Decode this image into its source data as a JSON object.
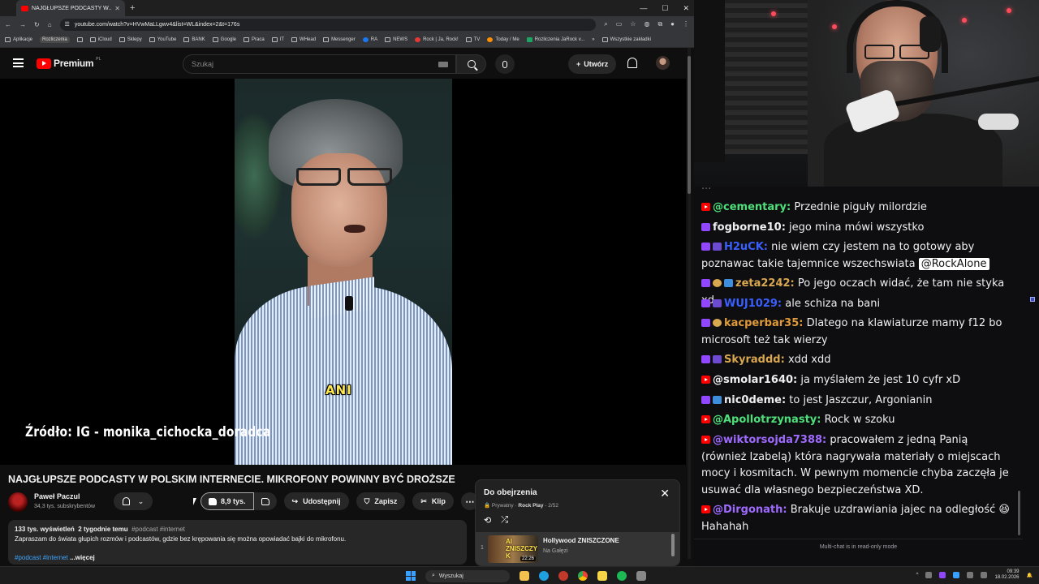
{
  "browser": {
    "tab_title": "NAJGŁUPSZE PODCASTY W...",
    "new_tab": "+",
    "window_controls": [
      "—",
      "☐",
      "✕"
    ],
    "url": "youtube.com/watch?v=HVwMaLLgwv4&list=WL&index=2&t=176s",
    "bookmarks": [
      "Aplikacje",
      "Rozliczenia",
      "iCloud",
      "Sklepy",
      "YouTube",
      "BANK",
      "Google",
      "Praca",
      "IT",
      "WHead",
      "Messenger",
      "RA",
      "NEWS",
      "Rock | Ja, Rock!",
      "TV",
      "Today / Me",
      "Rozliczenia JaRock v...",
      "Wszystkie zakładki"
    ]
  },
  "youtube": {
    "brand": "Premium",
    "country": "PL",
    "search_placeholder": "Szukaj",
    "create_label": "Utwórz",
    "create_plus": "+"
  },
  "video": {
    "caption": "ANI",
    "source_overlay": "Źródło: IG - monika_cichocka_doradca",
    "title": "NAJGŁUPSZE PODCASTY W POLSKIM INTERNECIE. MIKROFONY POWINNY BYĆ DROŻSZE",
    "channel_name": "Paweł Paczul",
    "channel_subs": "34,3 tys. subskrybentów",
    "likes": "8,9 tys.",
    "share_label": "Udostępnij",
    "save_label": "Zapisz",
    "clip_label": "Klip",
    "more_label": "⋯",
    "desc_views": "133 tys. wyświetleń",
    "desc_date": "2 tygodnie temu",
    "desc_hashtags": "#podcast #internet",
    "desc_text": "Zapraszam do świata głupich rozmów i podcastów, gdzie bez krępowania się można opowiadać bajki do mikrofonu.",
    "desc_tags2": "#podcast #internet",
    "desc_more": "...więcej"
  },
  "playlist": {
    "title": "Do obejrzenia",
    "privacy": "Prywatny",
    "owner": "Rock Play",
    "position": "2/52",
    "close": "✕",
    "loop": "⟲",
    "shuffle": "⤮",
    "item_index": "1",
    "item_thumb_text": "AI ZNISZCZY K",
    "item_duration": "22:26",
    "item_title": "Hollywood ZNISZCZONE",
    "item_channel": "Na Gałęzi"
  },
  "chat": {
    "cutoff_text": "...",
    "messages": [
      {
        "user": "@cementary:",
        "text": "Przednie piguły milordzie",
        "color": "#4ee07a"
      },
      {
        "user": "fogborne10:",
        "text": "jego mina mówi wszystko",
        "color": "#efeff1"
      },
      {
        "user": "H2uCK:",
        "text": "nie wiem czy jestem na to gotowy aby poznawac takie tajemnice wszechswiata",
        "mention": "@RockAlone",
        "color": "#3a5fff"
      },
      {
        "user": "zeta2242:",
        "text": "Po jego oczach widać, że tam nie styka xd",
        "color": "#d8a74f"
      },
      {
        "user": "WUJ1029:",
        "text": "ale schiza na bani",
        "color": "#3a5fff"
      },
      {
        "user": "kacperbar35:",
        "text": "Dlatego na klawiaturze mamy f12 bo microsoft też tak wierzy",
        "color": "#e09a3a"
      },
      {
        "user": "Skyraddd:",
        "text": "xdd xdd",
        "color": "#d8a74f"
      },
      {
        "user": "@smolar1640:",
        "text": "ja myślałem że jest 10 cyfr xD",
        "color": "#efeff1"
      },
      {
        "user": "nic0deme:",
        "text": "to jest Jaszczur, Argonianin",
        "color": "#efeff1"
      },
      {
        "user": "@Apollotrzynasty:",
        "text": "Rock w szoku",
        "color": "#4ee07a"
      },
      {
        "user": "@wiktorsojda7388:",
        "text": "pracowałem z jedną Panią (również Izabelą) która nagrywała materiały o miejscach mocy i kosmitach. W pewnym momencie chyba zaczęła je usuwać dla własnego bezpieczeństwa XD.",
        "color": "#9f6bff"
      },
      {
        "user": "@Dirgonath:",
        "text": "Brakuje uzdrawiania jajec na odległość 😆 Hahahah",
        "color": "#9f6bff"
      }
    ],
    "readonly_notice": "Multi-chat is in read-only mode"
  },
  "taskbar": {
    "search": "Wyszukaj",
    "time": "09:39",
    "date": "18.02.2026"
  },
  "colors": {
    "youtube_red": "#ff0000",
    "twitch_purple": "#9146ff",
    "link_blue": "#3ea6ff"
  }
}
